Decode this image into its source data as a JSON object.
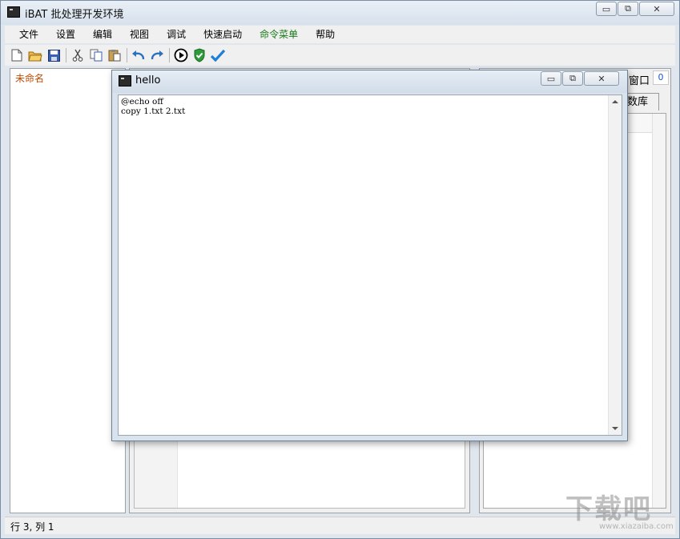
{
  "window": {
    "title": "iBAT 批处理开发环境",
    "controls": {
      "minimize": "▭",
      "restore": "⧉",
      "close": "✕"
    }
  },
  "menu": [
    "文件",
    "设置",
    "编辑",
    "视图",
    "调试",
    "快速启动",
    "命令菜单",
    "帮助"
  ],
  "toolbar": [
    "new-file-icon",
    "open-folder-icon",
    "save-icon",
    "cut-icon",
    "copy-icon",
    "paste-icon",
    "undo-icon",
    "redo-icon",
    "run-icon",
    "check-shield-icon",
    "checkmark-icon"
  ],
  "tree": {
    "item": "未命名"
  },
  "right_panel": {
    "title": "窗口",
    "count": "0",
    "tab": "数库"
  },
  "status": "行 3, 列 1",
  "hello": {
    "title": "hello",
    "code": "@echo off\ncopy 1.txt 2.txt"
  },
  "watermark": {
    "text": "下载吧",
    "url": "www.xiazaiba.com"
  },
  "colors": {
    "tree_item": "#c04a00",
    "menu_highlight": "#1a7a1a",
    "count": "#1f57c3"
  }
}
